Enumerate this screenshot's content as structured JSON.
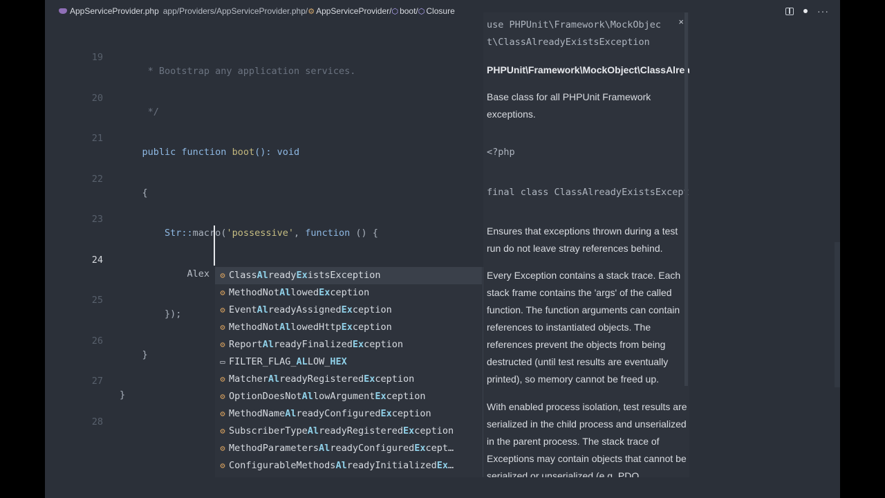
{
  "titlebar": {
    "file": "AppServiceProvider.php",
    "path": "app/Providers/AppServiceProvider.php/",
    "crumb_class": "AppServiceProvider/",
    "crumb_method": "boot/",
    "crumb_closure": "Closure"
  },
  "lines": [
    {
      "num": "19",
      "text": "     * Bootstrap any application services."
    },
    {
      "num": "20",
      "text": "     */"
    },
    {
      "num": "21",
      "kw": "    public function ",
      "fn": "boot",
      "rest": "(): void"
    },
    {
      "num": "22",
      "text": "    {"
    },
    {
      "num": "23",
      "cls": "        Str::",
      "fn": "macro",
      "p1": "(",
      "str": "'possessive'",
      "p2": ", ",
      "kw": "function",
      "rest": " () {"
    },
    {
      "num": "24",
      "text": "            Alex"
    },
    {
      "num": "25",
      "text": "        });"
    },
    {
      "num": "26",
      "text": "    }"
    },
    {
      "num": "27",
      "text": "}"
    },
    {
      "num": "28",
      "text": ""
    }
  ],
  "suggestions": [
    {
      "icon": "class-icon",
      "parts": [
        "Class",
        "Al",
        "ready",
        "Ex",
        "istsException"
      ]
    },
    {
      "icon": "class-icon",
      "parts": [
        "MethodNot",
        "Al",
        "lowed",
        "Ex",
        "ception"
      ]
    },
    {
      "icon": "class-icon",
      "parts": [
        "Event",
        "Al",
        "readyAssigned",
        "Ex",
        "ception"
      ]
    },
    {
      "icon": "class-icon",
      "parts": [
        "MethodNot",
        "Al",
        "lowedHttp",
        "Ex",
        "ception"
      ]
    },
    {
      "icon": "class-icon",
      "parts": [
        "Report",
        "Al",
        "readyFinalized",
        "Ex",
        "ception"
      ]
    },
    {
      "icon": "constant-icon",
      "parts": [
        "FILTER_FLAG_",
        "AL",
        "LOW_",
        "HEX",
        ""
      ]
    },
    {
      "icon": "class-icon",
      "parts": [
        "Matcher",
        "Al",
        "readyRegistered",
        "Ex",
        "ception"
      ]
    },
    {
      "icon": "class-icon",
      "parts": [
        "OptionDoesNot",
        "Al",
        "lowArgument",
        "Ex",
        "ception"
      ]
    },
    {
      "icon": "class-icon",
      "parts": [
        "MethodName",
        "Al",
        "readyConfigured",
        "Ex",
        "ception"
      ]
    },
    {
      "icon": "class-icon",
      "parts": [
        "SubscriberType",
        "Al",
        "readyRegistered",
        "Ex",
        "ception"
      ]
    },
    {
      "icon": "class-icon",
      "parts": [
        "MethodParameters",
        "Al",
        "readyConfigured",
        "Ex",
        "cept…"
      ]
    },
    {
      "icon": "class-icon",
      "parts": [
        "ConfigurableMethods",
        "Al",
        "readyInitialized",
        "Ex",
        "…"
      ]
    }
  ],
  "docs": {
    "use_line1": "use PHPUnit\\Framework\\MockObjec",
    "use_line2": "t\\ClassAlreadyExistsException",
    "fqcn": "PHPUnit\\Framework\\MockObject\\ClassAlreadyExistsException",
    "summary": "Base class for all PHPUnit Framework exceptions.",
    "php_open": "<?php",
    "class_decl": "final class ClassAlreadyExistsException",
    "p1": "Ensures that exceptions thrown during a test run do not leave stray references behind.",
    "p2": "Every Exception contains a stack trace. Each stack frame contains the 'args' of the called function. The function arguments can contain references to instantiated objects. The references prevent the objects from being destructed (until test results are eventually printed), so memory cannot be freed up.",
    "p3": "With enabled process isolation, test results are serialized in the child process and unserialized in the parent process. The stack trace of Exceptions may contain objects that cannot be serialized or unserialized (e.g. PDO"
  }
}
